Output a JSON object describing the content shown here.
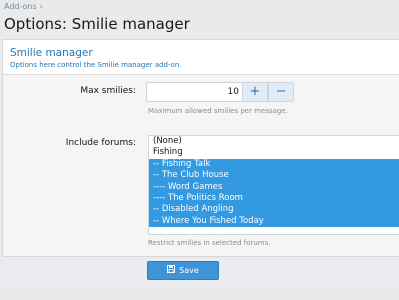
{
  "breadcrumb": {
    "item": "Add-ons",
    "separator": "›"
  },
  "page": {
    "title": "Options: Smilie manager"
  },
  "block": {
    "title": "Smilie manager",
    "description": "Options here control the Smilie manager add-on."
  },
  "max_smilies": {
    "label": "Max smilies:",
    "value": "10",
    "increment_label": "+",
    "decrement_label": "−",
    "hint": "Maximum allowed smilies per message."
  },
  "include_forums": {
    "label": "Include forums:",
    "options": [
      {
        "label": "(None)",
        "selected": false
      },
      {
        "label": "Fishing",
        "selected": false
      },
      {
        "label": "-- Fishing Talk",
        "selected": true
      },
      {
        "label": "-- The Club House",
        "selected": true
      },
      {
        "label": "---- Word Games",
        "selected": true
      },
      {
        "label": "---- The Politics Room",
        "selected": true
      },
      {
        "label": "-- Disabled Angling",
        "selected": true
      },
      {
        "label": "-- Where You Fished Today",
        "selected": true
      }
    ],
    "hint": "Restrict smilies in selected forums."
  },
  "save": {
    "label": "Save",
    "icon": "save-icon"
  },
  "colors": {
    "accent": "#2577b1",
    "selection": "#3399e0",
    "button": "#3e94d6"
  }
}
